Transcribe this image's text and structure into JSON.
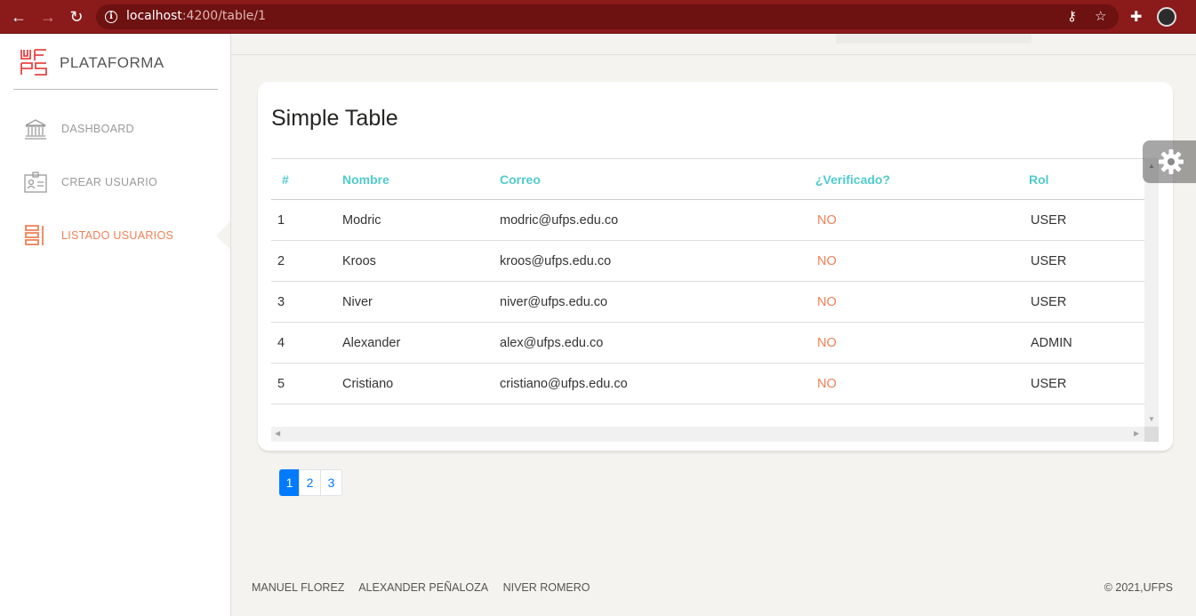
{
  "browser": {
    "url_host": "localhost",
    "url_path": ":4200/table/1"
  },
  "sidebar": {
    "brand": "PLATAFORMA",
    "items": [
      {
        "label": "DASHBOARD",
        "icon": "bank-icon",
        "active": false
      },
      {
        "label": "CREAR USUARIO",
        "icon": "id-card-icon",
        "active": false
      },
      {
        "label": "LISTADO USUARIOS",
        "icon": "list-icon",
        "active": true
      }
    ]
  },
  "card": {
    "title": "Simple Table",
    "columns": [
      "#",
      "Nombre",
      "Correo",
      "¿Verificado?",
      "Rol"
    ],
    "rows": [
      {
        "id": "1",
        "nombre": "Modric",
        "correo": "modric@ufps.edu.co",
        "verificado": "NO",
        "rol": "USER"
      },
      {
        "id": "2",
        "nombre": "Kroos",
        "correo": "kroos@ufps.edu.co",
        "verificado": "NO",
        "rol": "USER"
      },
      {
        "id": "3",
        "nombre": "Niver",
        "correo": "niver@ufps.edu.co",
        "verificado": "NO",
        "rol": "USER"
      },
      {
        "id": "4",
        "nombre": "Alexander",
        "correo": "alex@ufps.edu.co",
        "verificado": "NO",
        "rol": "ADMIN"
      },
      {
        "id": "5",
        "nombre": "Cristiano",
        "correo": "cristiano@ufps.edu.co",
        "verificado": "NO",
        "rol": "USER"
      }
    ]
  },
  "pagination": {
    "pages": [
      "1",
      "2",
      "3"
    ],
    "current": "1"
  },
  "footer": {
    "links": [
      "MANUEL FLOREZ",
      "ALEXANDER PEÑALOZA",
      "NIVER ROMERO"
    ],
    "copyright": "© 2021,UFPS"
  },
  "colors": {
    "accent": "#51cbce",
    "danger": "#ef8157",
    "primary": "#007bff",
    "chrome": "#8b1a1a"
  }
}
